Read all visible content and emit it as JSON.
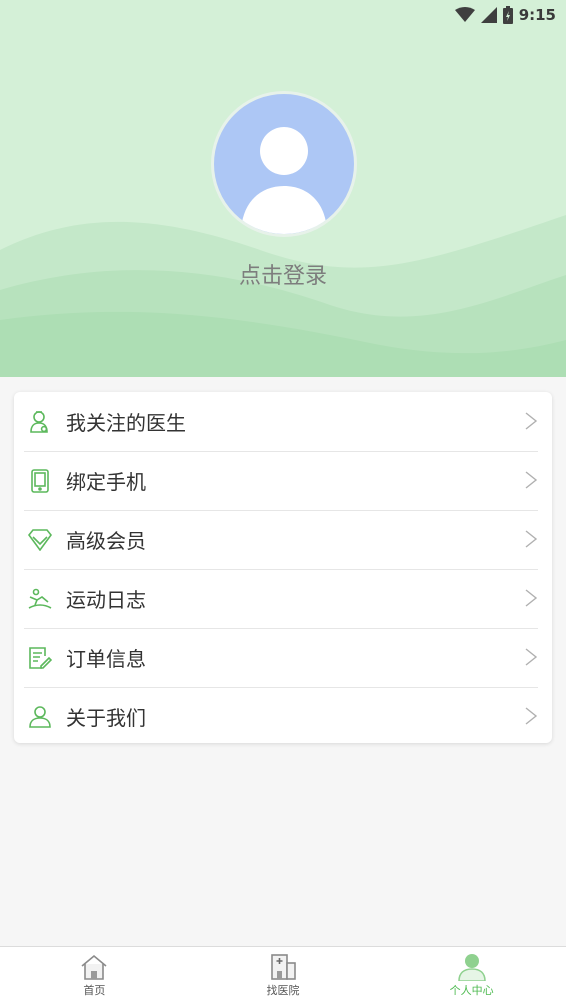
{
  "status_bar": {
    "time": "9:15"
  },
  "profile": {
    "login_label": "点击登录"
  },
  "menu": {
    "items": [
      {
        "label": "我关注的医生",
        "icon": "doctor-icon"
      },
      {
        "label": "绑定手机",
        "icon": "phone-icon"
      },
      {
        "label": "高级会员",
        "icon": "diamond-icon"
      },
      {
        "label": "运动日志",
        "icon": "exercise-icon"
      },
      {
        "label": "订单信息",
        "icon": "order-icon"
      },
      {
        "label": "关于我们",
        "icon": "person-icon"
      }
    ],
    "chevron": ">"
  },
  "tabbar": {
    "tabs": [
      {
        "label": "首页",
        "icon": "home-icon",
        "active": false
      },
      {
        "label": "找医院",
        "icon": "hospital-icon",
        "active": false
      },
      {
        "label": "个人中心",
        "icon": "user-center-icon",
        "active": true
      }
    ]
  },
  "colors": {
    "accent": "#4cb94f",
    "header_bg": "#d4f0d7",
    "avatar_bg": "#adc7f5",
    "icon_green": "#5cb85c"
  }
}
